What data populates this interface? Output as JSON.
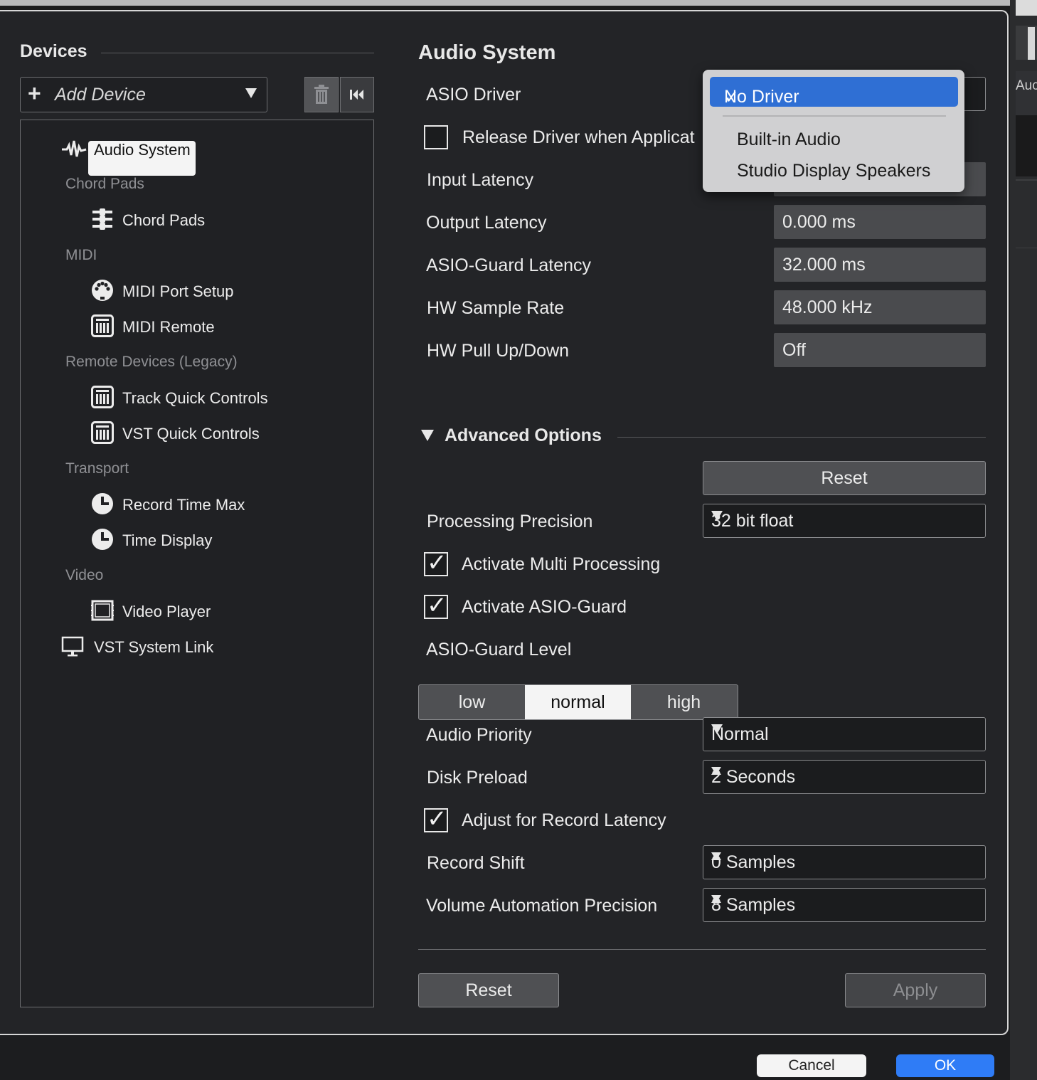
{
  "devices": {
    "title": "Devices",
    "add_device_label": "Add Device",
    "tree": {
      "audio_system": "Audio System",
      "cat_chord_pads": "Chord Pads",
      "chord_pads": "Chord Pads",
      "cat_midi": "MIDI",
      "midi_port_setup": "MIDI Port Setup",
      "midi_remote": "MIDI Remote",
      "cat_remote_legacy": "Remote Devices (Legacy)",
      "track_quick_controls": "Track Quick Controls",
      "vst_quick_controls": "VST Quick Controls",
      "cat_transport": "Transport",
      "record_time_max": "Record Time Max",
      "time_display": "Time Display",
      "cat_video": "Video",
      "video_player": "Video Player",
      "vst_system_link": "VST System Link"
    }
  },
  "audio_system": {
    "title": "Audio System",
    "asio_driver_label": "ASIO Driver",
    "release_driver_label": "Release Driver when Applicat",
    "input_latency_label": "Input Latency",
    "output_latency_label": "Output Latency",
    "output_latency_value": "0.000 ms",
    "asio_guard_latency_label": "ASIO-Guard Latency",
    "asio_guard_latency_value": "32.000 ms",
    "hw_sample_rate_label": "HW Sample Rate",
    "hw_sample_rate_value": "48.000 kHz",
    "hw_pull_label": "HW Pull Up/Down",
    "hw_pull_value": "Off"
  },
  "driver_menu": {
    "selected_check": "✓",
    "selected": "No Driver",
    "options": [
      "Built-in Audio",
      "Studio Display Speakers"
    ]
  },
  "advanced": {
    "title": "Advanced Options",
    "reset_label": "Reset",
    "processing_precision_label": "Processing Precision",
    "processing_precision_value": "32 bit float",
    "multi_processing_label": "Activate Multi Processing",
    "multi_processing_checked": true,
    "asio_guard_label": "Activate ASIO-Guard",
    "asio_guard_checked": true,
    "asio_guard_level_label": "ASIO-Guard Level",
    "levels": [
      "low",
      "normal",
      "high"
    ],
    "level_selected": "normal",
    "audio_priority_label": "Audio Priority",
    "audio_priority_value": "Normal",
    "disk_preload_label": "Disk Preload",
    "disk_preload_value": "2 Seconds",
    "adjust_record_latency_label": "Adjust for Record Latency",
    "adjust_record_latency_checked": true,
    "record_shift_label": "Record Shift",
    "record_shift_value": "0 Samples",
    "volume_automation_label": "Volume Automation Precision",
    "volume_automation_value": "8 Samples"
  },
  "footer": {
    "reset_label": "Reset",
    "apply_label": "Apply",
    "cancel_label": "Cancel",
    "ok_label": "OK"
  },
  "background": {
    "right_label": "Auc"
  },
  "colors": {
    "accent_blue": "#2f6fd4",
    "ok_button": "#2f7cf6"
  },
  "icons": {
    "check_mark": "✓"
  }
}
